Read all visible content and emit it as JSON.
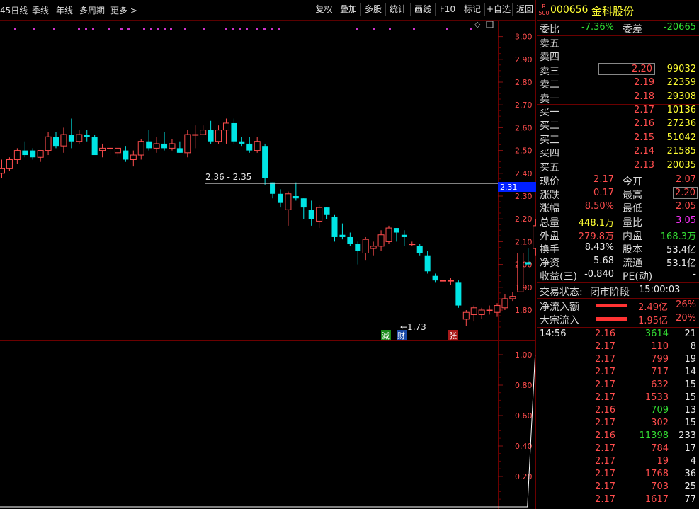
{
  "toolbar": {
    "periods": [
      "45日线",
      "季线",
      "年线",
      "多周期",
      "更多 >"
    ],
    "buttons": [
      "复权",
      "叠加",
      "多股",
      "统计",
      "画线",
      "F10",
      "标记",
      "+自选",
      "返回"
    ]
  },
  "stock": {
    "badge_top": "R",
    "badge_bottom": "500",
    "code": "000656",
    "name": "金科股份"
  },
  "price_axis": [
    "3.00",
    "2.90",
    "2.80",
    "2.70",
    "2.60",
    "2.50",
    "2.40",
    "2.30",
    "2.20",
    "2.10",
    "2.00",
    "1.90",
    "1.80"
  ],
  "indicator_axis": [
    "1.00",
    "0.80",
    "0.60",
    "0.40",
    "0.20"
  ],
  "annotations": {
    "range_label": "2.36 - 2.35",
    "current_price_tag": "2.31",
    "low_label": "←1.73",
    "markers": [
      "減",
      "财",
      "张"
    ]
  },
  "chart_data": {
    "type": "candlestick",
    "candles": [
      [
        2.4,
        2.46,
        2.38,
        2.42
      ],
      [
        2.42,
        2.47,
        2.41,
        2.46
      ],
      [
        2.46,
        2.51,
        2.44,
        2.5
      ],
      [
        2.5,
        2.54,
        2.47,
        2.48
      ],
      [
        2.5,
        2.51,
        2.46,
        2.47
      ],
      [
        2.47,
        2.5,
        2.45,
        2.5
      ],
      [
        2.5,
        2.58,
        2.48,
        2.56
      ],
      [
        2.56,
        2.58,
        2.51,
        2.52
      ],
      [
        2.52,
        2.6,
        2.49,
        2.57
      ],
      [
        2.57,
        2.64,
        2.51,
        2.54
      ],
      [
        2.54,
        2.59,
        2.53,
        2.57
      ],
      [
        2.57,
        2.59,
        2.54,
        2.56
      ],
      [
        2.56,
        2.57,
        2.5,
        2.48
      ],
      [
        2.5,
        2.53,
        2.47,
        2.51
      ],
      [
        2.51,
        2.52,
        2.48,
        2.51
      ],
      [
        2.49,
        2.51,
        2.47,
        2.51
      ],
      [
        2.5,
        2.52,
        2.45,
        2.46
      ],
      [
        2.46,
        2.5,
        2.43,
        2.48
      ],
      [
        2.48,
        2.55,
        2.46,
        2.54
      ],
      [
        2.54,
        2.59,
        2.5,
        2.51
      ],
      [
        2.51,
        2.56,
        2.49,
        2.53
      ],
      [
        2.53,
        2.58,
        2.5,
        2.51
      ],
      [
        2.51,
        2.55,
        2.5,
        2.53
      ],
      [
        2.51,
        2.54,
        2.49,
        2.49
      ],
      [
        2.49,
        2.59,
        2.47,
        2.57
      ],
      [
        2.57,
        2.61,
        2.51,
        2.57
      ],
      [
        2.57,
        2.61,
        2.57,
        2.59
      ],
      [
        2.59,
        2.63,
        2.53,
        2.54
      ],
      [
        2.54,
        2.61,
        2.53,
        2.59
      ],
      [
        2.59,
        2.64,
        2.53,
        2.62
      ],
      [
        2.62,
        2.64,
        2.53,
        2.54
      ],
      [
        2.54,
        2.56,
        2.52,
        2.53
      ],
      [
        2.53,
        2.56,
        2.49,
        2.5
      ],
      [
        2.5,
        2.56,
        2.49,
        2.54
      ],
      [
        2.52,
        2.53,
        2.35,
        2.38
      ],
      [
        2.36,
        2.36,
        2.29,
        2.31
      ],
      [
        2.31,
        2.33,
        2.25,
        2.27
      ],
      [
        2.24,
        2.32,
        2.17,
        2.31
      ],
      [
        2.3,
        2.36,
        2.28,
        2.29
      ],
      [
        2.29,
        2.29,
        2.2,
        2.25
      ],
      [
        2.24,
        2.28,
        2.17,
        2.2
      ],
      [
        2.19,
        2.26,
        2.16,
        2.25
      ],
      [
        2.25,
        2.25,
        2.2,
        2.22
      ],
      [
        2.21,
        2.22,
        2.1,
        2.12
      ],
      [
        2.13,
        2.18,
        2.11,
        2.12
      ],
      [
        2.12,
        2.14,
        2.08,
        2.09
      ],
      [
        2.09,
        2.1,
        2.0,
        2.06
      ],
      [
        2.05,
        2.12,
        2.02,
        2.11
      ],
      [
        2.07,
        2.1,
        2.04,
        2.08
      ],
      [
        2.08,
        2.15,
        2.06,
        2.13
      ],
      [
        2.1,
        2.17,
        2.09,
        2.16
      ],
      [
        2.16,
        2.16,
        2.1,
        2.14
      ],
      [
        2.13,
        2.15,
        2.08,
        2.12
      ],
      [
        2.09,
        2.1,
        2.08,
        2.09
      ],
      [
        2.08,
        2.09,
        2.04,
        2.05
      ],
      [
        2.04,
        2.06,
        1.96,
        1.97
      ],
      [
        1.95,
        1.96,
        1.92,
        1.93
      ],
      [
        1.93,
        1.94,
        1.92,
        1.93
      ],
      [
        1.93,
        1.94,
        1.91,
        1.93
      ],
      [
        1.92,
        1.93,
        1.81,
        1.82
      ],
      [
        1.76,
        1.8,
        1.73,
        1.79
      ],
      [
        1.78,
        1.82,
        1.75,
        1.81
      ],
      [
        1.78,
        1.81,
        1.76,
        1.8
      ],
      [
        1.8,
        1.82,
        1.78,
        1.8
      ],
      [
        1.79,
        1.83,
        1.77,
        1.82
      ],
      [
        1.81,
        1.87,
        1.8,
        1.85
      ],
      [
        1.85,
        1.88,
        1.84,
        1.86
      ],
      [
        1.88,
        2.05,
        1.88,
        2.05
      ],
      [
        2.01,
        2.07,
        2.0,
        2.0
      ],
      [
        2.07,
        2.2,
        2.04,
        2.17
      ]
    ],
    "indicator_values": [
      0,
      0,
      0,
      0,
      0,
      0,
      0,
      0,
      0,
      0,
      0,
      0,
      0,
      0,
      0,
      0,
      0,
      0,
      0,
      0,
      0,
      0,
      0,
      0,
      0,
      0,
      0,
      0,
      0,
      0,
      0,
      0,
      0,
      0,
      0,
      0,
      0,
      0,
      0,
      0,
      0,
      0,
      0,
      0,
      0,
      0,
      0,
      0,
      0,
      0,
      0,
      0,
      0,
      0,
      0,
      0,
      0,
      0,
      0,
      0,
      0,
      0,
      0,
      0,
      0,
      0,
      0,
      0,
      0,
      1
    ],
    "price_ylim": [
      1.7,
      3.03
    ],
    "indicator_ylim": [
      0,
      1.05
    ]
  },
  "quote": {
    "wei_bi_label": "委比",
    "wei_bi": "-7.36%",
    "wei_cha_label": "委差",
    "wei_cha": "-20665",
    "asks": [
      {
        "label": "卖五",
        "price": "",
        "vol": ""
      },
      {
        "label": "卖四",
        "price": "",
        "vol": ""
      },
      {
        "label": "卖三",
        "price": "2.20",
        "vol": "99032"
      },
      {
        "label": "卖二",
        "price": "2.19",
        "vol": "22359"
      },
      {
        "label": "卖一",
        "price": "2.18",
        "vol": "29308"
      }
    ],
    "bids": [
      {
        "label": "买一",
        "price": "2.17",
        "vol": "10136"
      },
      {
        "label": "买二",
        "price": "2.16",
        "vol": "27236"
      },
      {
        "label": "买三",
        "price": "2.15",
        "vol": "51042"
      },
      {
        "label": "买四",
        "price": "2.14",
        "vol": "21585"
      },
      {
        "label": "买五",
        "price": "2.13",
        "vol": "20035"
      }
    ],
    "stats": [
      {
        "l1": "现价",
        "v1": "2.17",
        "c1": "red",
        "l2": "今开",
        "v2": "2.07",
        "c2": "red"
      },
      {
        "l1": "涨跌",
        "v1": "0.17",
        "c1": "red",
        "l2": "最高",
        "v2": "2.20",
        "c2": "red"
      },
      {
        "l1": "涨幅",
        "v1": "8.50%",
        "c1": "red",
        "l2": "最低",
        "v2": "2.05",
        "c2": "red"
      },
      {
        "l1": "总量",
        "v1": "448.1万",
        "c1": "yel",
        "l2": "量比",
        "v2": "3.05",
        "c2": "mag"
      },
      {
        "l1": "外盘",
        "v1": "279.8万",
        "c1": "red",
        "l2": "内盘",
        "v2": "168.3万",
        "c2": "grn"
      }
    ],
    "stats2": [
      {
        "l1": "换手",
        "v1": "8.43%",
        "l2": "股本",
        "v2": "53.4亿"
      },
      {
        "l1": "净资",
        "v1": "5.68",
        "l2": "流通",
        "v2": "53.1亿"
      },
      {
        "l1": "收益(三)",
        "v1": "-0.840",
        "l2": "PE(动)",
        "v2": "-"
      }
    ],
    "trade_status_label": "交易状态:",
    "trade_status": "闭市阶段",
    "trade_time": "15:00:03",
    "flows": [
      {
        "label": "净流入额",
        "value": "2.49亿",
        "pct": "26%"
      },
      {
        "label": "大宗流入",
        "value": "1.95亿",
        "pct": "20%"
      }
    ]
  },
  "ticks": [
    {
      "time": "14:56",
      "price": "2.16",
      "vol": "3614",
      "n": "21",
      "pc": "red",
      "vc": "grn"
    },
    {
      "time": "",
      "price": "2.17",
      "vol": "110",
      "n": "8",
      "pc": "red",
      "vc": "red"
    },
    {
      "time": "",
      "price": "2.17",
      "vol": "799",
      "n": "19",
      "pc": "red",
      "vc": "red"
    },
    {
      "time": "",
      "price": "2.17",
      "vol": "717",
      "n": "14",
      "pc": "red",
      "vc": "red"
    },
    {
      "time": "",
      "price": "2.17",
      "vol": "632",
      "n": "15",
      "pc": "red",
      "vc": "red"
    },
    {
      "time": "",
      "price": "2.17",
      "vol": "1533",
      "n": "15",
      "pc": "red",
      "vc": "red"
    },
    {
      "time": "",
      "price": "2.16",
      "vol": "709",
      "n": "13",
      "pc": "red",
      "vc": "grn"
    },
    {
      "time": "",
      "price": "2.17",
      "vol": "302",
      "n": "15",
      "pc": "red",
      "vc": "red"
    },
    {
      "time": "",
      "price": "2.16",
      "vol": "11398",
      "n": "233",
      "pc": "red",
      "vc": "grn"
    },
    {
      "time": "",
      "price": "2.17",
      "vol": "784",
      "n": "17",
      "pc": "red",
      "vc": "red"
    },
    {
      "time": "",
      "price": "2.17",
      "vol": "19",
      "n": "4",
      "pc": "red",
      "vc": "red"
    },
    {
      "time": "",
      "price": "2.17",
      "vol": "1768",
      "n": "36",
      "pc": "red",
      "vc": "red"
    },
    {
      "time": "",
      "price": "2.17",
      "vol": "703",
      "n": "25",
      "pc": "red",
      "vc": "red"
    },
    {
      "time": "",
      "price": "2.17",
      "vol": "1617",
      "n": "77",
      "pc": "red",
      "vc": "red"
    }
  ],
  "colors": {
    "up": "#ff4d4d",
    "down": "#00e5e5",
    "border": "#6b0000",
    "price_tag_bg": "#0020ff"
  }
}
